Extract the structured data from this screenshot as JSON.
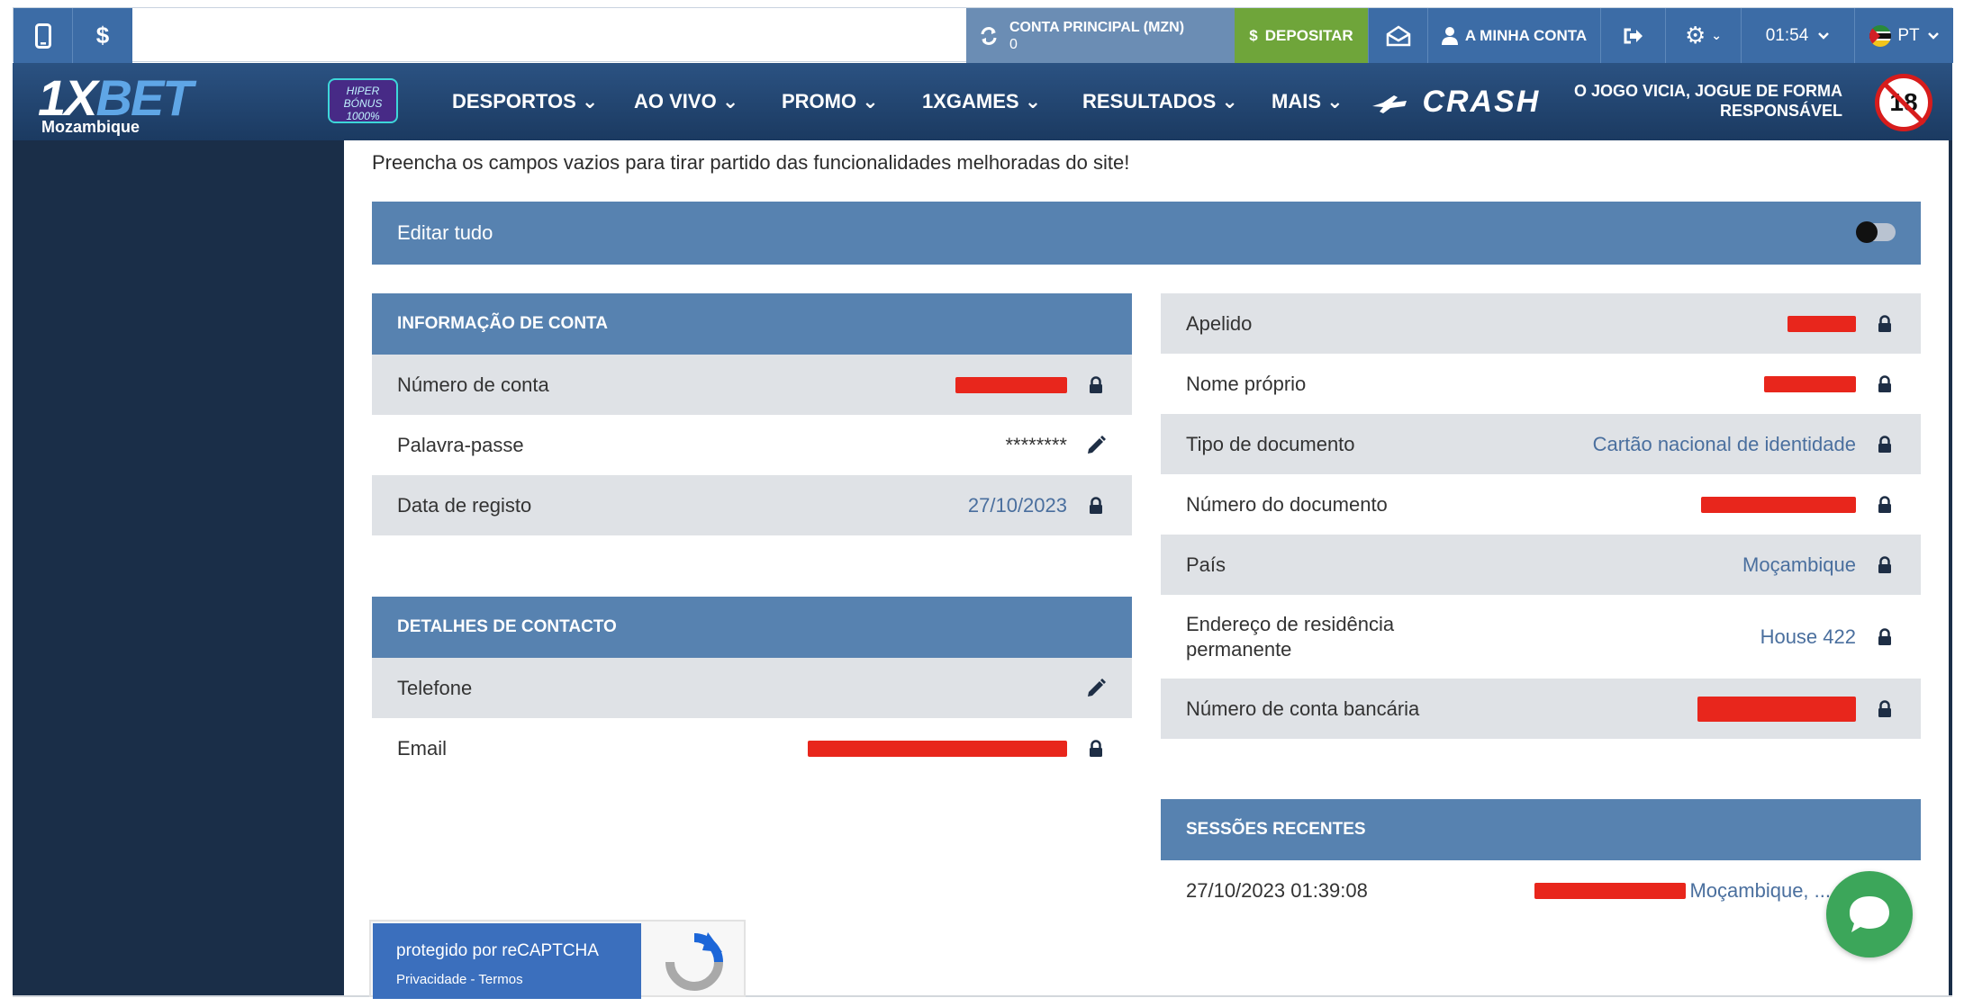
{
  "topbar": {
    "account_label": "CONTA PRINCIPAL (MZN)",
    "account_balance": "0",
    "deposit_label": "DEPOSITAR",
    "my_account_label": "A MINHA CONTA",
    "time": "01:54",
    "language": "PT"
  },
  "nav": {
    "logo_main": "1X",
    "logo_accent": "BET",
    "logo_region": "Mozambique",
    "promo_badge": "HIPER BÓNUS 1000%",
    "items": [
      "DESPORTOS",
      "AO VIVO",
      "PROMO",
      "1XGAMES",
      "RESULTADOS",
      "MAIS"
    ],
    "crash_label": "CRASH",
    "responsible": "O JOGO VICIA, JOGUE DE FORMA RESPONSÁVEL",
    "age_badge": "18"
  },
  "notice": "Preencha os campos vazios para tirar partido das funcionalidades melhoradas do site!",
  "edit_all": "Editar tudo",
  "account_info": {
    "title": "INFORMAÇÃO DE CONTA",
    "rows": [
      {
        "label": "Número de conta",
        "value": ""
      },
      {
        "label": "Palavra-passe",
        "value": "********"
      },
      {
        "label": "Data de registo",
        "value": "27/10/2023"
      }
    ]
  },
  "contact": {
    "title": "DETALHES DE CONTACTO",
    "rows": [
      {
        "label": "Telefone",
        "value": ""
      },
      {
        "label": "Email",
        "value": ""
      }
    ]
  },
  "personal": {
    "rows": [
      {
        "label": "Apelido",
        "value": ""
      },
      {
        "label": "Nome próprio",
        "value": ""
      },
      {
        "label": "Tipo de documento",
        "value": "Cartão nacional de identidade"
      },
      {
        "label": "Número do documento",
        "value": ""
      },
      {
        "label": "País",
        "value": "Moçambique"
      },
      {
        "label": "Endereço de residência permanente",
        "value": "House 422"
      },
      {
        "label": "Número de conta bancária",
        "value": ""
      }
    ]
  },
  "sessions": {
    "title": "SESSÕES RECENTES",
    "rows": [
      {
        "date": "27/10/2023 01:39:08",
        "location": "Moçambique, ..."
      }
    ]
  },
  "captcha": {
    "label": "protegido por reCAPTCHA",
    "links": "Privacidade - Termos"
  },
  "colors": {
    "header_blue": "#3c6ca6",
    "nav_dark": "#1b3a61",
    "panel_head": "#5782b0",
    "deposit_green": "#6fa53a",
    "row_shade": "#dfe2e6",
    "value_blue": "#4a6f9e",
    "redaction": "#e8261c",
    "chat_green": "#3ca65a"
  }
}
